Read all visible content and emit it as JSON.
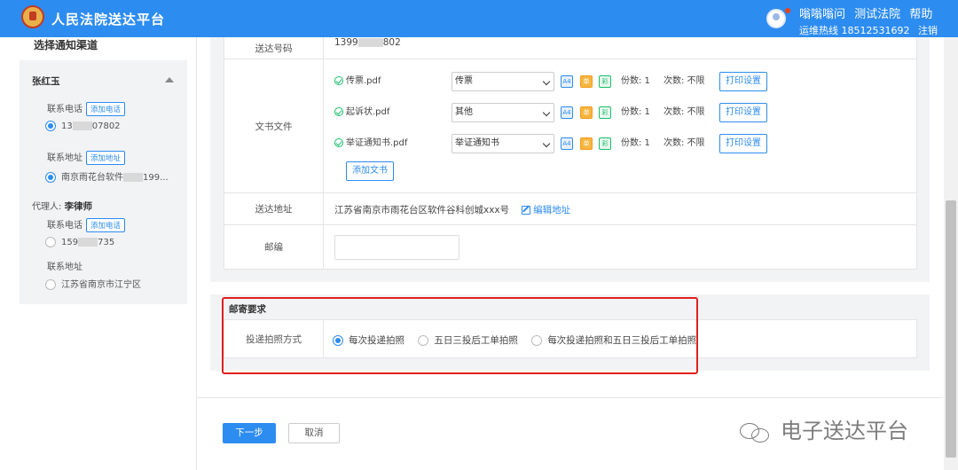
{
  "header": {
    "brand": "人民法院送达平台",
    "links": [
      "嗡嗡嗡问",
      "测试法院",
      "帮助"
    ],
    "hotline": "运维热线 18512531692",
    "logout": "注销"
  },
  "left": {
    "title": "选择通知渠道",
    "party_name": "张红玉",
    "phone_label": "联系电话",
    "add_phone": "添加电话",
    "phone_prefix": "13",
    "phone_suffix": "07802",
    "address_label": "联系地址",
    "add_address": "添加地址",
    "address_prefix": "南京雨花台软件",
    "address_suffix": "199...",
    "agent_label": "代理人:",
    "agent_name": "李律师",
    "agent_phone_label": "联系电话",
    "agent_add_phone": "添加电话",
    "agent_phone_prefix": "159",
    "agent_phone_suffix": "735",
    "agent_address_label": "联系地址",
    "agent_address": "江苏省南京市江宁区"
  },
  "form": {
    "serve_no_label": "送达号码",
    "serve_no_prefix": "1399",
    "serve_no_suffix": "802",
    "docs_label": "文书文件",
    "docs": [
      {
        "name": "传票.pdf",
        "type": "传票"
      },
      {
        "name": "起诉状.pdf",
        "type": "其他"
      },
      {
        "name": "举证通知书.pdf",
        "type": "举证通知书"
      }
    ],
    "tag_a4": "A4",
    "tag_single": "单",
    "tag_color": "彩",
    "copies": "份数: 1",
    "times": "次数: 不限",
    "print_settings": "打印设置",
    "add_doc": "添加文书",
    "addr_label": "送达地址",
    "addr_value": "江苏省南京市雨花台区软件谷科创城xxx号",
    "edit_addr": "编辑地址",
    "zip_label": "邮编"
  },
  "postal": {
    "title": "邮寄要求",
    "method_label": "投递拍照方式",
    "options": [
      "每次投递拍照",
      "五日三投后工单拍照",
      "每次投递拍照和五日三投后工单拍照"
    ],
    "selected_index": 0
  },
  "actions": {
    "next": "下一步",
    "cancel": "取消"
  },
  "watermark": "电子送达平台"
}
